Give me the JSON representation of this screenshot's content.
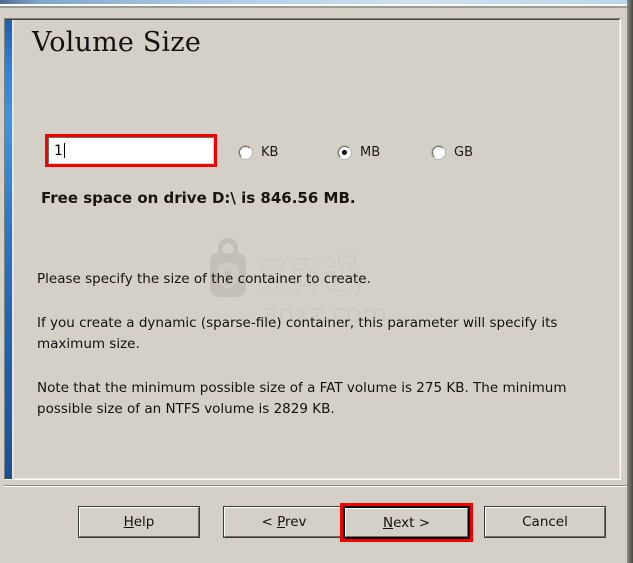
{
  "window": {
    "accent_color": "#2f81d8",
    "face_color": "#d4d0c8",
    "highlight_color": "#f40000"
  },
  "page_title": "Volume Size",
  "size_field": {
    "name": "volume-size",
    "value": "1",
    "placeholder": ""
  },
  "units": {
    "selected": "MB",
    "options": [
      {
        "id": "kb",
        "label": "KB",
        "checked": false
      },
      {
        "id": "mb",
        "label": "MB",
        "checked": true
      },
      {
        "id": "gb",
        "label": "GB",
        "checked": false
      }
    ]
  },
  "free_space_text": "Free space on drive D:\\ is 846.56 MB.",
  "paragraphs": [
    "Please specify the size of the container to create.",
    "If you create a dynamic (sparse-file) container, this parameter will specify its maximum size.",
    "Note that the minimum possible size of a FAT volume is 275 KB. The minimum possible size of an NTFS volume is 2829 KB."
  ],
  "watermark": {
    "site": "anxz.com",
    "chinese": "安下载"
  },
  "buttons": {
    "help": {
      "prefix": "",
      "accel": "H",
      "suffix": "elp"
    },
    "prev": {
      "prefix": "< ",
      "accel": "P",
      "suffix": "rev"
    },
    "next": {
      "prefix": "",
      "accel": "N",
      "suffix": "ext >"
    },
    "cancel": {
      "prefix": "Cancel",
      "accel": "",
      "suffix": ""
    }
  }
}
